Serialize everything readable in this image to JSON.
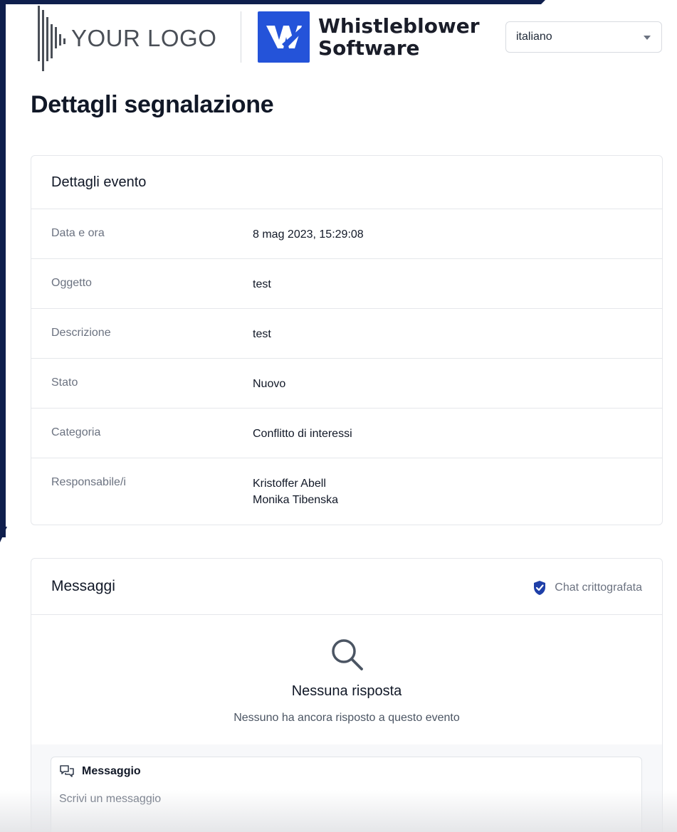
{
  "header": {
    "your_logo_text": "YOUR LOGO",
    "brand_line1": "Whistleblower",
    "brand_line2": "Software",
    "language": "italiano"
  },
  "page_title": "Dettagli segnalazione",
  "details": {
    "title": "Dettagli evento",
    "rows": [
      {
        "label": "Data e ora",
        "value": "8 mag 2023, 15:29:08"
      },
      {
        "label": "Oggetto",
        "value": "test"
      },
      {
        "label": "Descrizione",
        "value": "test"
      },
      {
        "label": "Stato",
        "value": "Nuovo"
      },
      {
        "label": "Categoria",
        "value": "Conflitto di interessi"
      },
      {
        "label": "Responsabile/i",
        "value_lines": [
          "Kristoffer Abell",
          "Monika Tibenska"
        ]
      }
    ]
  },
  "messages": {
    "title": "Messaggi",
    "encrypted_label": "Chat crittografata",
    "empty_title": "Nessuna risposta",
    "empty_subtitle": "Nessuno ha ancora risposto a questo evento",
    "compose_label": "Messaggio",
    "compose_placeholder": "Scrivi un messaggio"
  },
  "colors": {
    "frame": "#0f1f4d",
    "brand_blue": "#2453d9",
    "shield_blue": "#1e3fa8"
  },
  "icons": [
    "your-logo-bars-icon",
    "whistleblower-logo-icon",
    "chevron-down-icon",
    "shield-check-icon",
    "search-icon",
    "chat-bubbles-icon"
  ]
}
